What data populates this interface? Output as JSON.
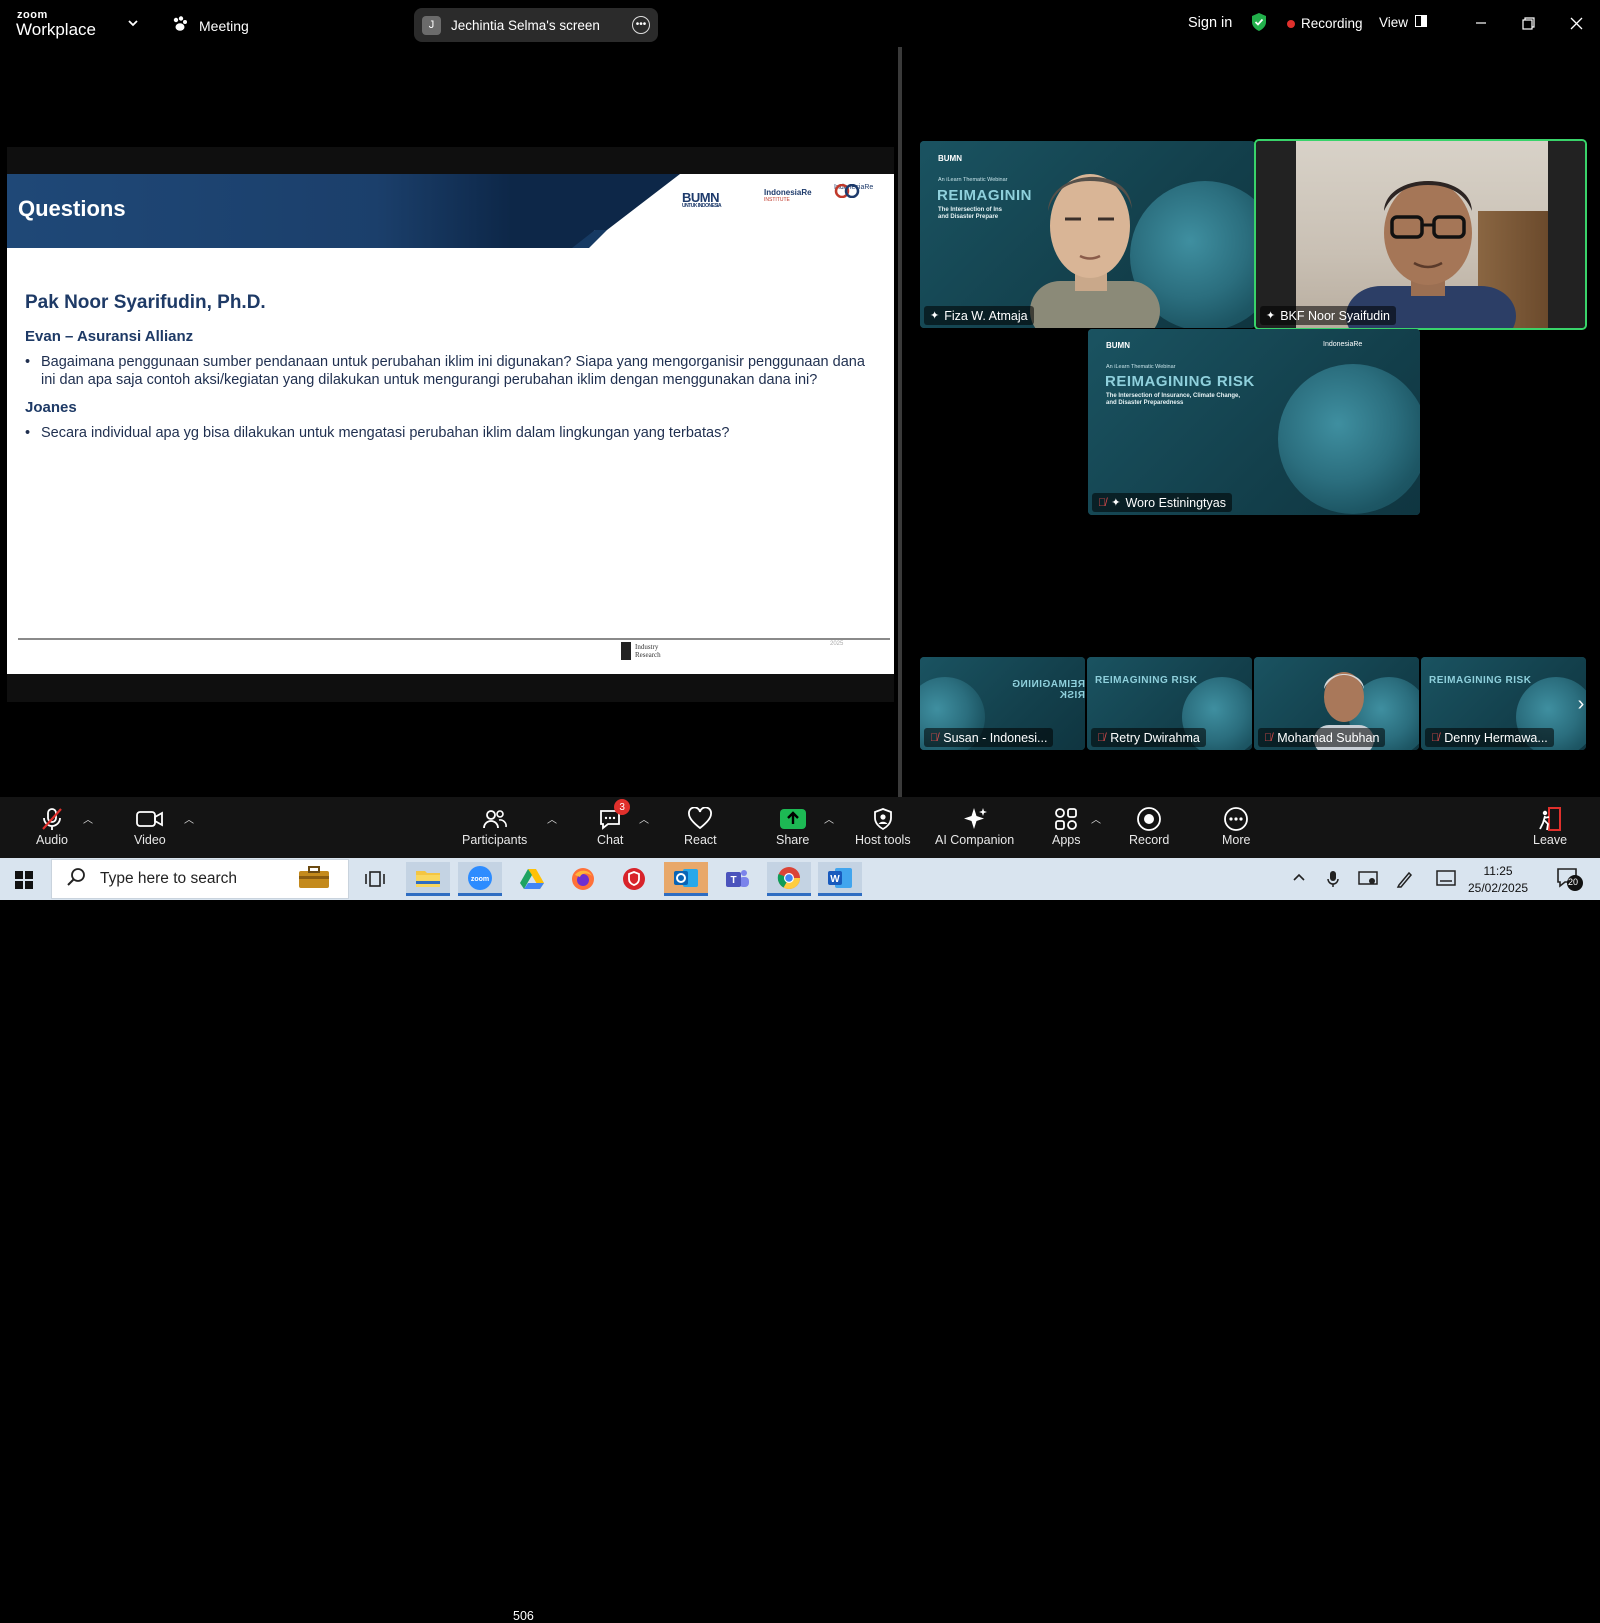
{
  "titlebar": {
    "brand_small": "zoom",
    "brand_big": "Workplace",
    "meeting_label": "Meeting",
    "share_initial": "J",
    "share_label": "Jechintia Selma's screen",
    "sign_in": "Sign in",
    "recording": "Recording",
    "view": "View"
  },
  "slide": {
    "heading": "Questions",
    "logo_bumn": "BUMN",
    "logo_bumn_sub": "UNTUK INDONESIA",
    "logo_ire": "IndonesiaRe",
    "logo_ire_sub": "INSTITUTE",
    "logo_ire2": "IndonesiaRe",
    "speaker": "Pak Noor Syarifudin, Ph.D.",
    "questions": [
      {
        "person": "Evan – Asuransi Allianz",
        "text": "Bagaimana penggunaan sumber pendanaan untuk perubahan iklim ini digunakan? Siapa yang mengorganisir penggunaan dana ini dan apa saja contoh aksi/kegiatan yang dilakukan untuk mengurangi perubahan iklim dengan menggunakan dana ini?"
      },
      {
        "person": "Joanes",
        "text": "Secara individual apa yg bisa dilakukan untuk mengatasi perubahan iklim dalam lingkungan yang terbatas?"
      }
    ],
    "footer_logo_line1": "Industry",
    "footer_logo_line2": "Research",
    "footer_year": "2025"
  },
  "webinar": {
    "small": "An iLearn Thematic Webinar",
    "title": "REIMAGINING RISK",
    "title_partial": "REIMAGININ",
    "sub1": "The Intersection of Insurance, Climate Change,",
    "sub2": "and Disaster Preparedness",
    "sub1_partial": "The Intersection of Ins",
    "sub2_partial": "and Disaster Prepare",
    "bumn": "BUMN",
    "ire": "IndonesiaRe"
  },
  "participants_tiles": {
    "main": [
      {
        "name": "Fiza W. Atmaja"
      },
      {
        "name": "BKF Noor Syaifudin"
      },
      {
        "name": "Woro Estiningtyas"
      }
    ],
    "strip": [
      {
        "name": "Susan - Indonesi..."
      },
      {
        "name": "Retry Dwirahma"
      },
      {
        "name": "Mohamad Subhan"
      },
      {
        "name": "Denny Hermawa..."
      }
    ]
  },
  "toolbar": {
    "audio": "Audio",
    "video": "Video",
    "participants": "Participants",
    "participants_count": "506",
    "chat": "Chat",
    "chat_badge": "3",
    "react": "React",
    "share": "Share",
    "host_tools": "Host tools",
    "ai_companion": "AI Companion",
    "apps": "Apps",
    "record": "Record",
    "more": "More",
    "leave": "Leave"
  },
  "taskbar": {
    "search_placeholder": "Type here to search",
    "time": "11:25",
    "date": "25/02/2025",
    "notif_count": "20"
  },
  "colors": {
    "slide_navy": "#1e3a66",
    "active_speaker": "#39d36a",
    "share_green": "#1db954",
    "recording_red": "#e0302c"
  }
}
